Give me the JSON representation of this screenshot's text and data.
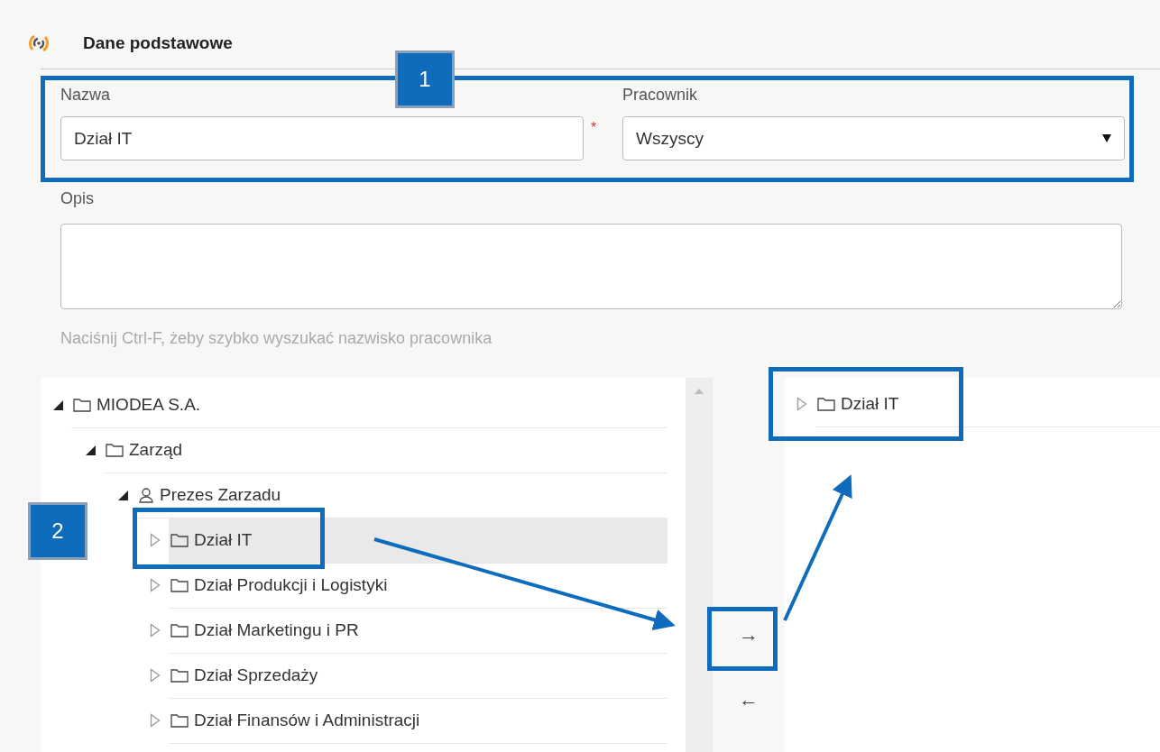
{
  "section": {
    "title": "Dane podstawowe"
  },
  "fields": {
    "name": {
      "label": "Nazwa",
      "value": "Dział IT",
      "required_mark": "*"
    },
    "employee": {
      "label": "Pracownik",
      "value": "Wszyscy"
    },
    "description": {
      "label": "Opis"
    }
  },
  "hint": "Naciśnij Ctrl-F, żeby szybko wyszukać nazwisko pracownika",
  "tree": [
    {
      "label": "MIODEA S.A.",
      "kind": "folder",
      "expanded": true,
      "selected": false,
      "children": [
        {
          "label": "Zarząd",
          "kind": "folder",
          "expanded": true,
          "selected": false,
          "children": [
            {
              "label": "Prezes Zarzadu",
              "kind": "person",
              "expanded": true,
              "selected": false,
              "children": [
                {
                  "label": "Dział IT",
                  "kind": "folder",
                  "expanded": false,
                  "selected": true
                },
                {
                  "label": "Dział Produkcji i Logistyki",
                  "kind": "folder",
                  "expanded": false,
                  "selected": false
                },
                {
                  "label": "Dział Marketingu i PR",
                  "kind": "folder",
                  "expanded": false,
                  "selected": false
                },
                {
                  "label": "Dział Sprzedaży",
                  "kind": "folder",
                  "expanded": false,
                  "selected": false
                },
                {
                  "label": "Dział Finansów i Administracji",
                  "kind": "folder",
                  "expanded": false,
                  "selected": false
                }
              ]
            }
          ]
        }
      ]
    }
  ],
  "transfer_buttons": [
    {
      "label": "→"
    },
    {
      "label": "←"
    }
  ],
  "selected_tree": [
    {
      "label": "Dział IT",
      "kind": "folder",
      "expanded": false,
      "selected": false
    }
  ],
  "callouts": [
    {
      "label": "1"
    },
    {
      "label": "2"
    }
  ]
}
